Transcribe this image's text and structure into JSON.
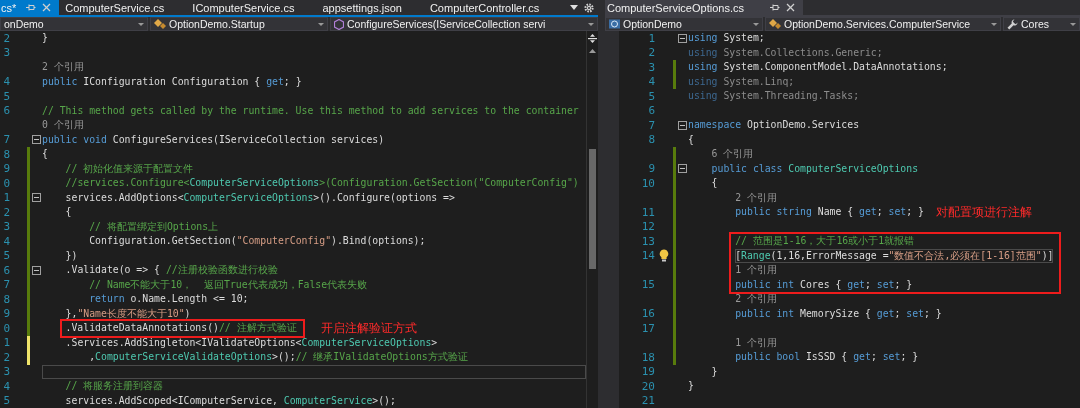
{
  "panes": [
    {
      "focused": true,
      "tab_menu": true,
      "scrollbar": true,
      "tabs": [
        {
          "label": "cs*",
          "selected": true,
          "close_button": true
        },
        {
          "label": "ComputerService.cs",
          "selected": false,
          "close_button": false
        },
        {
          "label": "IComputerService.cs",
          "selected": false,
          "close_button": false
        },
        {
          "label": "appsettings.json",
          "selected": false,
          "close_button": false
        },
        {
          "label": "ComputerController.cs",
          "selected": false,
          "close_button": false
        }
      ],
      "nav": [
        {
          "kind": "plain",
          "label": "onDemo"
        },
        {
          "kind": "class",
          "label": "OptionDemo.Startup"
        },
        {
          "kind": "method",
          "label": "ConfigureServices(IServiceCollection servi"
        }
      ],
      "blocks": [
        {
          "kind": "code",
          "number": "2",
          "modified": false,
          "fold": false,
          "current": false,
          "hint": false,
          "tokens": [
            {
              "kind": "plain",
              "text": "}"
            }
          ]
        },
        {
          "kind": "code",
          "number": "3",
          "modified": false,
          "fold": false,
          "current": false,
          "hint": false
        },
        {
          "kind": "lens",
          "modified": false,
          "text": "2 个引用"
        },
        {
          "kind": "code",
          "number": "4",
          "modified": false,
          "fold": false,
          "current": false,
          "hint": false,
          "tokens": [
            {
              "kind": "keyword",
              "text": "public"
            },
            {
              "kind": "plain",
              "text": " IConfiguration Configuration { "
            },
            {
              "kind": "keyword",
              "text": "get"
            },
            {
              "kind": "plain",
              "text": "; }"
            }
          ]
        },
        {
          "kind": "code",
          "number": "5",
          "modified": false,
          "fold": false,
          "current": false,
          "hint": false
        },
        {
          "kind": "code",
          "number": "6",
          "modified": false,
          "fold": false,
          "current": false,
          "hint": false,
          "tokens": [
            {
              "kind": "comment",
              "text": "// This method gets called by the runtime. Use this method to add services to the container"
            }
          ]
        },
        {
          "kind": "lens",
          "modified": false,
          "text": "0 个引用"
        },
        {
          "kind": "code",
          "number": "7",
          "modified": false,
          "fold": true,
          "current": false,
          "hint": false,
          "tokens": [
            {
              "kind": "keyword",
              "text": "public void"
            },
            {
              "kind": "plain",
              "text": " ConfigureServices(IServiceCollection services)"
            }
          ]
        },
        {
          "kind": "code",
          "number": "8",
          "modified": true,
          "saved": true,
          "fold": false,
          "current": false,
          "hint": false,
          "tokens": [
            {
              "kind": "plain",
              "text": "{"
            }
          ]
        },
        {
          "kind": "code",
          "number": "9",
          "modified": true,
          "saved": true,
          "fold": false,
          "current": false,
          "hint": false,
          "tokens": [
            {
              "kind": "comment",
              "text": "    // 初始化值来源于配置文件"
            }
          ]
        },
        {
          "kind": "code",
          "number": "0",
          "modified": true,
          "saved": true,
          "fold": false,
          "current": false,
          "hint": false,
          "tokens": [
            {
              "kind": "comment",
              "text": "    //services.Configure<"
            },
            {
              "kind": "type",
              "text": "ComputerServiceOptions"
            },
            {
              "kind": "comment",
              "text": ">(Configuration.GetSection(\"ComputerConfig\")"
            }
          ]
        },
        {
          "kind": "code",
          "number": "1",
          "modified": true,
          "saved": true,
          "fold": true,
          "current": false,
          "hint": false,
          "tokens": [
            {
              "kind": "plain",
              "text": "    services.AddOptions<"
            },
            {
              "kind": "type",
              "text": "ComputerServiceOptions"
            },
            {
              "kind": "plain",
              "text": ">().Configure(options =>"
            }
          ]
        },
        {
          "kind": "code",
          "number": "2",
          "modified": true,
          "saved": true,
          "fold": false,
          "current": false,
          "hint": false,
          "tokens": [
            {
              "kind": "plain",
              "text": "    {"
            }
          ]
        },
        {
          "kind": "code",
          "number": "3",
          "modified": true,
          "saved": true,
          "fold": false,
          "current": false,
          "hint": false,
          "tokens": [
            {
              "kind": "comment",
              "text": "        // 将配置绑定到Options上"
            }
          ]
        },
        {
          "kind": "code",
          "number": "4",
          "modified": true,
          "saved": true,
          "fold": false,
          "current": false,
          "hint": false,
          "tokens": [
            {
              "kind": "plain",
              "text": "        Configuration.GetSection("
            },
            {
              "kind": "string",
              "text": "\"ComputerConfig\""
            },
            {
              "kind": "plain",
              "text": ").Bind(options);"
            }
          ]
        },
        {
          "kind": "code",
          "number": "5",
          "modified": true,
          "saved": true,
          "fold": false,
          "current": false,
          "hint": false,
          "tokens": [
            {
              "kind": "plain",
              "text": "    })"
            }
          ]
        },
        {
          "kind": "code",
          "number": "6",
          "modified": true,
          "saved": true,
          "fold": true,
          "current": false,
          "hint": false,
          "tokens": [
            {
              "kind": "plain",
              "text": "    .Validate(o => { "
            },
            {
              "kind": "comment",
              "text": "//注册校验函数进行校验"
            }
          ]
        },
        {
          "kind": "code",
          "number": "7",
          "modified": true,
          "saved": true,
          "fold": false,
          "current": false,
          "hint": false,
          "tokens": [
            {
              "kind": "comment",
              "text": "        // Name不能大于10，  返回True代表成功，False代表失败"
            }
          ]
        },
        {
          "kind": "code",
          "number": "8",
          "modified": true,
          "saved": true,
          "fold": false,
          "current": false,
          "hint": false,
          "tokens": [
            {
              "kind": "keyword",
              "text": "        return"
            },
            {
              "kind": "plain",
              "text": " o.Name.Length <= 10;"
            }
          ]
        },
        {
          "kind": "code",
          "number": "9",
          "modified": true,
          "saved": true,
          "fold": false,
          "current": false,
          "hint": false,
          "tokens": [
            {
              "kind": "plain",
              "text": "    },"
            },
            {
              "kind": "string",
              "text": "\"Name长度不能大于10\""
            },
            {
              "kind": "plain",
              "text": ")"
            }
          ]
        },
        {
          "kind": "box",
          "note": "开启注解验证方式",
          "lines": [
            {
              "kind": "code",
              "number": "0",
              "modified": true,
              "saved": true,
              "fold": false,
              "current": false,
              "hint": false,
              "tokens": [
                {
                  "kind": "plain",
                  "text": "    .ValidateDataAnnotations()"
                },
                {
                  "kind": "comment",
                  "text": "// 注解方式验证"
                }
              ]
            }
          ]
        },
        {
          "kind": "code",
          "number": "1",
          "modified": true,
          "saved": false,
          "fold": false,
          "current": false,
          "hint": false,
          "tokens": [
            {
              "kind": "plain",
              "text": "    .Services.AddSingleton<IValidateOptions<"
            },
            {
              "kind": "type",
              "text": "ComputerServiceOptions"
            },
            {
              "kind": "plain",
              "text": ">"
            }
          ]
        },
        {
          "kind": "code",
          "number": "2",
          "modified": true,
          "saved": false,
          "fold": false,
          "current": false,
          "hint": false,
          "tokens": [
            {
              "kind": "plain",
              "text": "        ,"
            },
            {
              "kind": "type",
              "text": "ComputerServiceValidateOptions"
            },
            {
              "kind": "plain",
              "text": ">();"
            },
            {
              "kind": "comment",
              "text": "// 继承IValidateOptions方式验证"
            }
          ]
        },
        {
          "kind": "code",
          "number": "3",
          "modified": false,
          "fold": false,
          "current": true,
          "hint": false
        },
        {
          "kind": "code",
          "number": "4",
          "modified": false,
          "fold": false,
          "current": false,
          "hint": false,
          "tokens": [
            {
              "kind": "comment",
              "text": "    // 将服务注册到容器"
            }
          ]
        },
        {
          "kind": "code",
          "number": "5",
          "modified": false,
          "fold": false,
          "current": false,
          "hint": false,
          "tokens": [
            {
              "kind": "plain",
              "text": "    services.AddScoped<IComputerService, "
            },
            {
              "kind": "type",
              "text": "ComputerService"
            },
            {
              "kind": "plain",
              "text": ">();"
            }
          ]
        }
      ]
    },
    {
      "focused": false,
      "tab_menu": false,
      "scrollbar": false,
      "tabs": [
        {
          "label": "ComputerServiceOptions.cs",
          "selected": false,
          "close_button": true
        }
      ],
      "nav": [
        {
          "kind": "project",
          "label": "OptionDemo"
        },
        {
          "kind": "class",
          "label": "OptionDemo.Services.ComputerService"
        },
        {
          "kind": "property",
          "label": "Cores"
        }
      ],
      "blocks": [
        {
          "kind": "code",
          "number": "1",
          "modified": false,
          "fold": true,
          "current": false,
          "hint": false,
          "tokens": [
            {
              "kind": "keyword",
              "text": "using"
            },
            {
              "kind": "plain",
              "text": " System;"
            }
          ]
        },
        {
          "kind": "code",
          "number": "2",
          "modified": false,
          "fold": false,
          "current": false,
          "hint": false,
          "tokens": [
            {
              "kind": "dim-keyword",
              "text": "using"
            },
            {
              "kind": "dim-plain",
              "text": " System.Collections.Generic;"
            }
          ]
        },
        {
          "kind": "code",
          "number": "3",
          "modified": true,
          "saved": true,
          "fold": false,
          "current": false,
          "hint": false,
          "tokens": [
            {
              "kind": "keyword",
              "text": "using"
            },
            {
              "kind": "plain",
              "text": " System.ComponentModel.DataAnnotations;"
            }
          ]
        },
        {
          "kind": "code",
          "number": "4",
          "modified": true,
          "saved": true,
          "fold": false,
          "current": false,
          "hint": false,
          "tokens": [
            {
              "kind": "dim-keyword",
              "text": "using"
            },
            {
              "kind": "dim-plain",
              "text": " System.Linq;"
            }
          ]
        },
        {
          "kind": "code",
          "number": "5",
          "modified": false,
          "fold": false,
          "current": false,
          "hint": false,
          "tokens": [
            {
              "kind": "dim-keyword",
              "text": "using"
            },
            {
              "kind": "dim-plain",
              "text": " System.Threading.Tasks;"
            }
          ]
        },
        {
          "kind": "code",
          "number": "6",
          "modified": false,
          "fold": false,
          "current": false,
          "hint": false
        },
        {
          "kind": "code",
          "number": "7",
          "modified": false,
          "fold": true,
          "current": false,
          "hint": false,
          "tokens": [
            {
              "kind": "keyword",
              "text": "namespace"
            },
            {
              "kind": "plain",
              "text": " OptionDemo.Services"
            }
          ]
        },
        {
          "kind": "code",
          "number": "8",
          "modified": false,
          "fold": false,
          "current": false,
          "hint": false,
          "tokens": [
            {
              "kind": "plain",
              "text": "{"
            }
          ]
        },
        {
          "kind": "lens",
          "modified": true,
          "saved": true,
          "text": "    6 个引用"
        },
        {
          "kind": "code",
          "number": "9",
          "modified": true,
          "saved": true,
          "fold": true,
          "current": false,
          "hint": false,
          "tokens": [
            {
              "kind": "keyword",
              "text": "    public class"
            },
            {
              "kind": "type",
              "text": " ComputerServiceOptions"
            }
          ]
        },
        {
          "kind": "code",
          "number": "10",
          "modified": true,
          "saved": true,
          "fold": false,
          "current": false,
          "hint": false,
          "tokens": [
            {
              "kind": "plain",
              "text": "    {"
            }
          ]
        },
        {
          "kind": "lens",
          "modified": true,
          "saved": true,
          "text": "        2 个引用"
        },
        {
          "kind": "code",
          "number": "11",
          "modified": true,
          "saved": true,
          "fold": false,
          "current": false,
          "hint": false,
          "note": "对配置项进行注解",
          "tokens": [
            {
              "kind": "keyword",
              "text": "        public string"
            },
            {
              "kind": "plain",
              "text": " Name { "
            },
            {
              "kind": "keyword",
              "text": "get"
            },
            {
              "kind": "plain",
              "text": "; "
            },
            {
              "kind": "keyword",
              "text": "set"
            },
            {
              "kind": "plain",
              "text": "; }"
            }
          ]
        },
        {
          "kind": "code",
          "number": "12",
          "modified": true,
          "saved": true,
          "fold": false,
          "current": false,
          "hint": false
        },
        {
          "kind": "box",
          "lines": [
            {
              "kind": "code",
              "number": "13",
              "modified": true,
              "saved": true,
              "fold": false,
              "current": false,
              "hint": false,
              "tokens": [
                {
                  "kind": "comment",
                  "text": "        // 范围是1-16，大于16或小于1就报错"
                }
              ]
            },
            {
              "kind": "code",
              "number": "14",
              "modified": true,
              "saved": true,
              "fold": false,
              "current": true,
              "hint": true,
              "tokens": [
                {
                  "kind": "plain",
                  "text": "        ["
                },
                {
                  "kind": "type",
                  "text": "Range"
                },
                {
                  "kind": "plain",
                  "text": "(1,16,ErrorMessage ="
                },
                {
                  "kind": "string",
                  "text": "\"数值不合法,必须在[1-16]范围\""
                },
                {
                  "kind": "plain",
                  "text": ")]"
                }
              ]
            },
            {
              "kind": "lens",
              "modified": true,
              "saved": true,
              "text": "        1 个引用"
            },
            {
              "kind": "code",
              "number": "15",
              "modified": true,
              "saved": true,
              "fold": false,
              "current": false,
              "hint": false,
              "tokens": [
                {
                  "kind": "keyword",
                  "text": "        public int"
                },
                {
                  "kind": "plain",
                  "text": " Cores { "
                },
                {
                  "kind": "keyword",
                  "text": "get"
                },
                {
                  "kind": "plain",
                  "text": "; "
                },
                {
                  "kind": "keyword",
                  "text": "set"
                },
                {
                  "kind": "plain",
                  "text": "; }"
                }
              ]
            }
          ]
        },
        {
          "kind": "lens",
          "modified": true,
          "saved": true,
          "text": "        2 个引用"
        },
        {
          "kind": "code",
          "number": "16",
          "modified": true,
          "saved": true,
          "fold": false,
          "current": false,
          "hint": false,
          "tokens": [
            {
              "kind": "keyword",
              "text": "        public int"
            },
            {
              "kind": "plain",
              "text": " MemorySize { "
            },
            {
              "kind": "keyword",
              "text": "get"
            },
            {
              "kind": "plain",
              "text": "; "
            },
            {
              "kind": "keyword",
              "text": "set"
            },
            {
              "kind": "plain",
              "text": "; }"
            }
          ]
        },
        {
          "kind": "code",
          "number": "17",
          "modified": true,
          "saved": true,
          "fold": false,
          "current": false,
          "hint": false
        },
        {
          "kind": "lens",
          "modified": true,
          "saved": true,
          "text": "        1 个引用"
        },
        {
          "kind": "code",
          "number": "18",
          "modified": true,
          "saved": true,
          "fold": false,
          "current": false,
          "hint": false,
          "tokens": [
            {
              "kind": "keyword",
              "text": "        public bool"
            },
            {
              "kind": "plain",
              "text": " IsSSD { "
            },
            {
              "kind": "keyword",
              "text": "get"
            },
            {
              "kind": "plain",
              "text": "; "
            },
            {
              "kind": "keyword",
              "text": "set"
            },
            {
              "kind": "plain",
              "text": "; }"
            }
          ]
        },
        {
          "kind": "code",
          "number": "19",
          "modified": false,
          "fold": false,
          "current": false,
          "hint": false,
          "tokens": [
            {
              "kind": "plain",
              "text": "    }"
            }
          ]
        },
        {
          "kind": "code",
          "number": "20",
          "modified": false,
          "fold": false,
          "current": false,
          "hint": false,
          "tokens": [
            {
              "kind": "plain",
              "text": "}"
            }
          ]
        },
        {
          "kind": "code",
          "number": "21",
          "modified": false,
          "fold": false,
          "current": false,
          "hint": false
        }
      ]
    }
  ]
}
